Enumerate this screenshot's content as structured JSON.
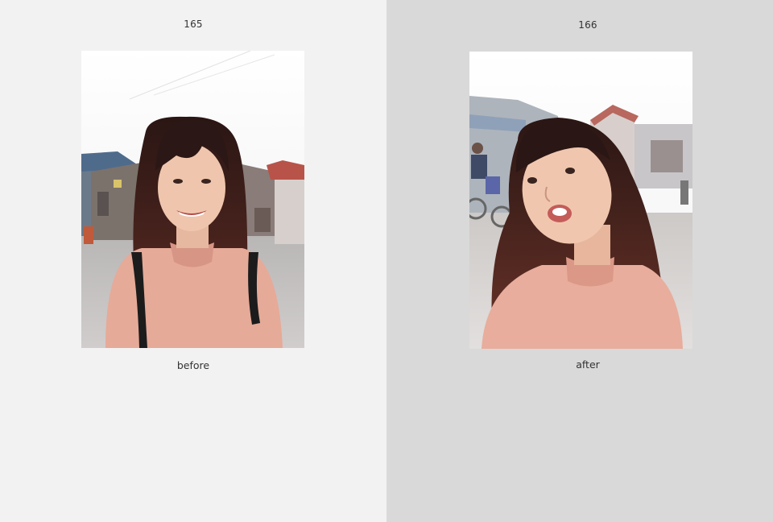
{
  "spread": {
    "left_page": {
      "page_number": "165",
      "caption": "before",
      "photo_icon": "photo-portrait-smiling"
    },
    "right_page": {
      "page_number": "166",
      "caption": "after",
      "photo_icon": "photo-portrait-close-up"
    }
  },
  "colors": {
    "left_page_bg": "#f2f2f2",
    "right_page_bg": "#d9d9d9",
    "shirt": "#e6aa98",
    "hair": "#3a1f1a",
    "sky": "#fbfbfb"
  }
}
